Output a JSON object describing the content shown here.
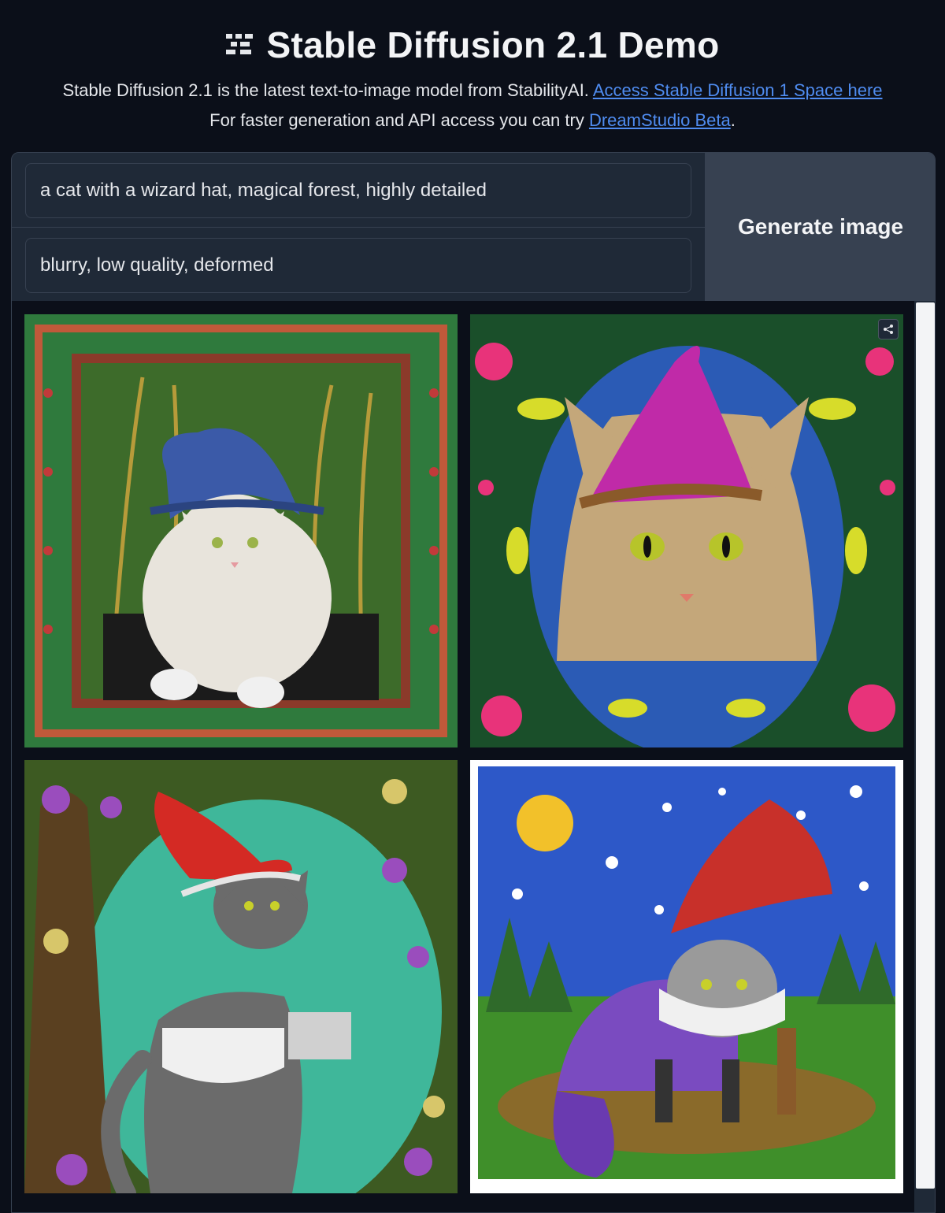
{
  "header": {
    "title": "Stable Diffusion 2.1 Demo",
    "description_text": "Stable Diffusion 2.1 is the latest text-to-image model from StabilityAI. ",
    "link1_label": "Access Stable Diffusion 1 Space here",
    "line2_text": "For faster generation and API access you can try ",
    "link2_label": "DreamStudio Beta",
    "line2_end": "."
  },
  "form": {
    "prompt_value": "a cat with a wizard hat, magical forest, highly detailed",
    "negative_prompt_value": "blurry, low quality, deformed",
    "generate_label": "Generate image"
  },
  "gallery": {
    "images": [
      {
        "name": "cat-blue-wizard-hat-framed-forest",
        "frame": "#2f7a3d",
        "bg": "#3d6b2a",
        "hat": "#3b5aa8",
        "cat": "#e8e4dc",
        "accent": "#b23a2b"
      },
      {
        "name": "cat-pink-wizard-hat-flowers",
        "frame": "#1a4f2a",
        "bg": "#2b5bb5",
        "hat": "#c02aa8",
        "cat": "#c4a77a",
        "accent": "#e8337a"
      },
      {
        "name": "cat-red-wizard-hat-tree-flowers",
        "frame": "#3d5a22",
        "bg": "#3fb79a",
        "hat": "#d42a24",
        "cat": "#6b6b6b",
        "accent": "#9a4dbd"
      },
      {
        "name": "cat-red-wizard-hat-starry-night",
        "frame": "#ffffff",
        "bg": "#2d58c8",
        "hat": "#c8302a",
        "cat": "#7a4bc0",
        "accent": "#3f8f2a"
      }
    ],
    "share_icon": "share-icon"
  }
}
